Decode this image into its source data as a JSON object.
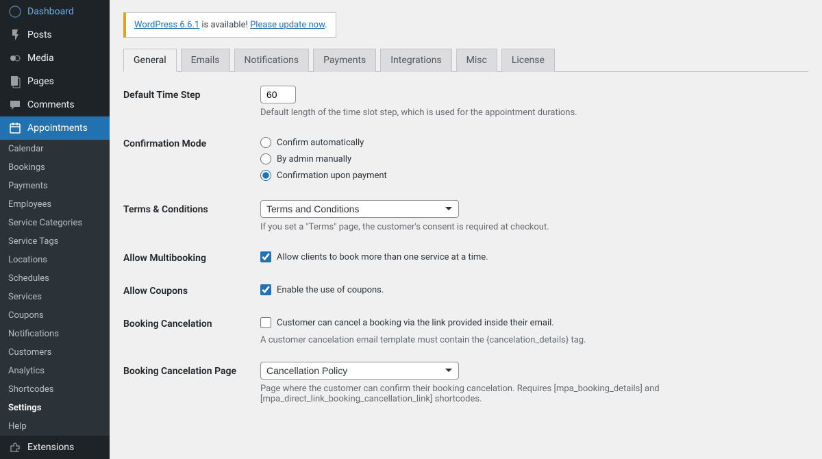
{
  "sidebar": {
    "top": [
      {
        "icon": "dashboard",
        "label": "Dashboard"
      },
      {
        "icon": "pin",
        "label": "Posts"
      },
      {
        "icon": "media",
        "label": "Media"
      },
      {
        "icon": "pages",
        "label": "Pages"
      },
      {
        "icon": "comments",
        "label": "Comments"
      },
      {
        "icon": "calendar",
        "label": "Appointments"
      }
    ],
    "submenu": [
      "Calendar",
      "Bookings",
      "Payments",
      "Employees",
      "Service Categories",
      "Service Tags",
      "Locations",
      "Schedules",
      "Services",
      "Coupons",
      "Notifications",
      "Customers",
      "Analytics",
      "Shortcodes",
      "Settings",
      "Help"
    ],
    "extensions": "Extensions"
  },
  "notice": {
    "link1": "WordPress 6.6.1",
    "mid": " is available! ",
    "link2": "Please update now",
    "tail": "."
  },
  "tabs": [
    "General",
    "Emails",
    "Notifications",
    "Payments",
    "Integrations",
    "Misc",
    "License"
  ],
  "settings": {
    "time_step": {
      "label": "Default Time Step",
      "value": "60",
      "desc": "Default length of the time slot step, which is used for the appointment durations."
    },
    "confirm": {
      "label": "Confirmation Mode",
      "options": [
        "Confirm automatically",
        "By admin manually",
        "Confirmation upon payment"
      ],
      "selected": 2
    },
    "terms": {
      "label": "Terms & Conditions",
      "value": "Terms and Conditions",
      "desc": "If you set a \"Terms\" page, the customer's consent is required at checkout."
    },
    "multi": {
      "label": "Allow Multibooking",
      "text": "Allow clients to book more than one service at a time.",
      "checked": true
    },
    "coupons": {
      "label": "Allow Coupons",
      "text": "Enable the use of coupons.",
      "checked": true
    },
    "cancel": {
      "label": "Booking Cancelation",
      "text": "Customer can cancel a booking via the link provided inside their email.",
      "checked": false,
      "desc": "A customer cancelation email template must contain the {cancelation_details} tag."
    },
    "cancel_page": {
      "label": "Booking Cancelation Page",
      "value": "Cancellation Policy",
      "desc": "Page where the customer can confirm their booking cancelation. Requires [mpa_booking_details] and [mpa_direct_link_booking_cancellation_link] shortcodes."
    }
  }
}
